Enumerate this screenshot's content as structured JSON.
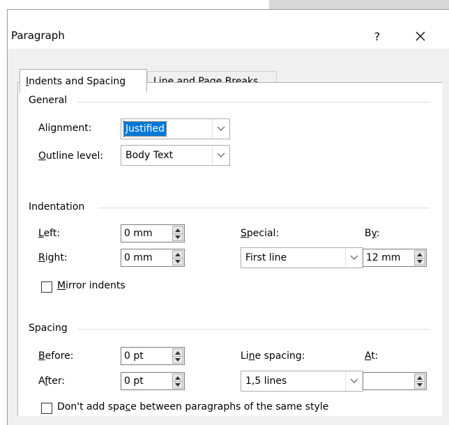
{
  "dialog": {
    "title": "Paragraph",
    "help_label": "?"
  },
  "tabs": [
    {
      "label_pre": "",
      "accel": "I",
      "label_post": "ndents and Spacing"
    },
    {
      "label_pre": "Line and ",
      "accel": "P",
      "label_post": "age Breaks"
    }
  ],
  "general": {
    "title": "General",
    "alignment": {
      "label_pre": "Ali",
      "accel": "g",
      "label_post": "nment:",
      "value": "Justified"
    },
    "outline_level": {
      "label_pre": "",
      "accel": "O",
      "label_post": "utline level:",
      "value": "Body Text"
    }
  },
  "indentation": {
    "title": "Indentation",
    "left": {
      "label_pre": "",
      "accel": "L",
      "label_post": "eft:",
      "value": "0 mm"
    },
    "right": {
      "label_pre": "",
      "accel": "R",
      "label_post": "ight:",
      "value": "0 mm"
    },
    "special": {
      "label_pre": "",
      "accel": "S",
      "label_post": "pecial:",
      "value": "First line"
    },
    "by": {
      "label_pre": "B",
      "accel": "y",
      "label_post": ":",
      "value": "12 mm"
    },
    "mirror": {
      "label_pre": "",
      "accel": "M",
      "label_post": "irror indents",
      "checked": false
    }
  },
  "spacing": {
    "title": "Spacing",
    "before": {
      "label_pre": "",
      "accel": "B",
      "label_post": "efore:",
      "value": "0 pt"
    },
    "after": {
      "label_pre": "A",
      "accel": "f",
      "label_post": "ter:",
      "value": "0 pt"
    },
    "line_spacing": {
      "label_pre": "Li",
      "accel": "n",
      "label_post": "e spacing:",
      "value": "1,5 lines"
    },
    "at": {
      "label_pre": "",
      "accel": "A",
      "label_post": "t:",
      "value": ""
    },
    "dont_add": {
      "label_pre": "Don't add spa",
      "accel": "c",
      "label_post": "e between paragraphs of the same style",
      "checked": false
    }
  },
  "colors": {
    "selection": "#0078d7",
    "dialog_bg": "#f0f0f0",
    "panel_bg": "#ffffff"
  },
  "icons": {
    "close": "close-icon",
    "dropdown": "chevron-down-icon",
    "spin_up": "spin-up-icon",
    "spin_down": "spin-down-icon"
  }
}
